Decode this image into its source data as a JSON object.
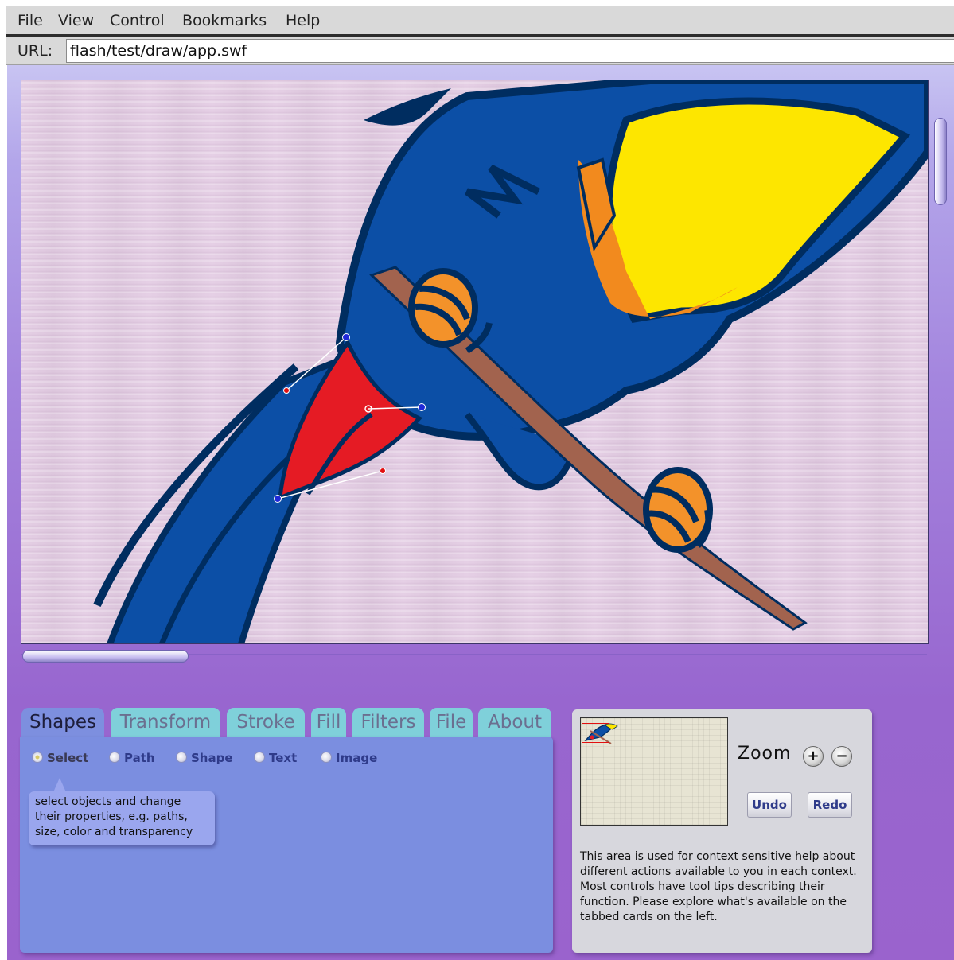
{
  "menubar": {
    "items": [
      "File",
      "View",
      "Control",
      "Bookmarks",
      "Help"
    ]
  },
  "urlbar": {
    "label": "URL:",
    "value": "flash/test/draw/app.swf"
  },
  "tabs": [
    "Shapes",
    "Transform",
    "Stroke",
    "Fill",
    "Filters",
    "File",
    "About"
  ],
  "active_tab": "Shapes",
  "tools": {
    "selected": "Select",
    "options": [
      "Select",
      "Path",
      "Shape",
      "Text",
      "Image"
    ]
  },
  "tooltip": {
    "lines": [
      "select objects and change",
      "their properties, e.g. paths,",
      "size, color and transparency"
    ]
  },
  "zoom": {
    "label": "Zoom",
    "in_symbol": "+",
    "out_symbol": "−"
  },
  "history": {
    "undo_label": "Undo",
    "redo_label": "Redo"
  },
  "help": {
    "lines": [
      "This area is used for context sensitive help about",
      "different actions available to you in each context.",
      "Most controls have tool tips describing their",
      "function. Please explore what's available on the",
      "tabbed cards on the left."
    ]
  },
  "colors": {
    "bird_blue": "#0c4fa6",
    "bird_outline": "#002d60",
    "wing_yellow": "#fde600",
    "wing_orange": "#f28a1e",
    "branch_brown": "#a2634e",
    "band_orange": "#f3922a",
    "selected_red": "#e51b24",
    "stage_purple": "#9a63cd",
    "tab_active": "#7d8fdf",
    "tab_inactive": "#7fd0da"
  },
  "icons": [
    "zoom-in-icon",
    "zoom-out-icon"
  ]
}
